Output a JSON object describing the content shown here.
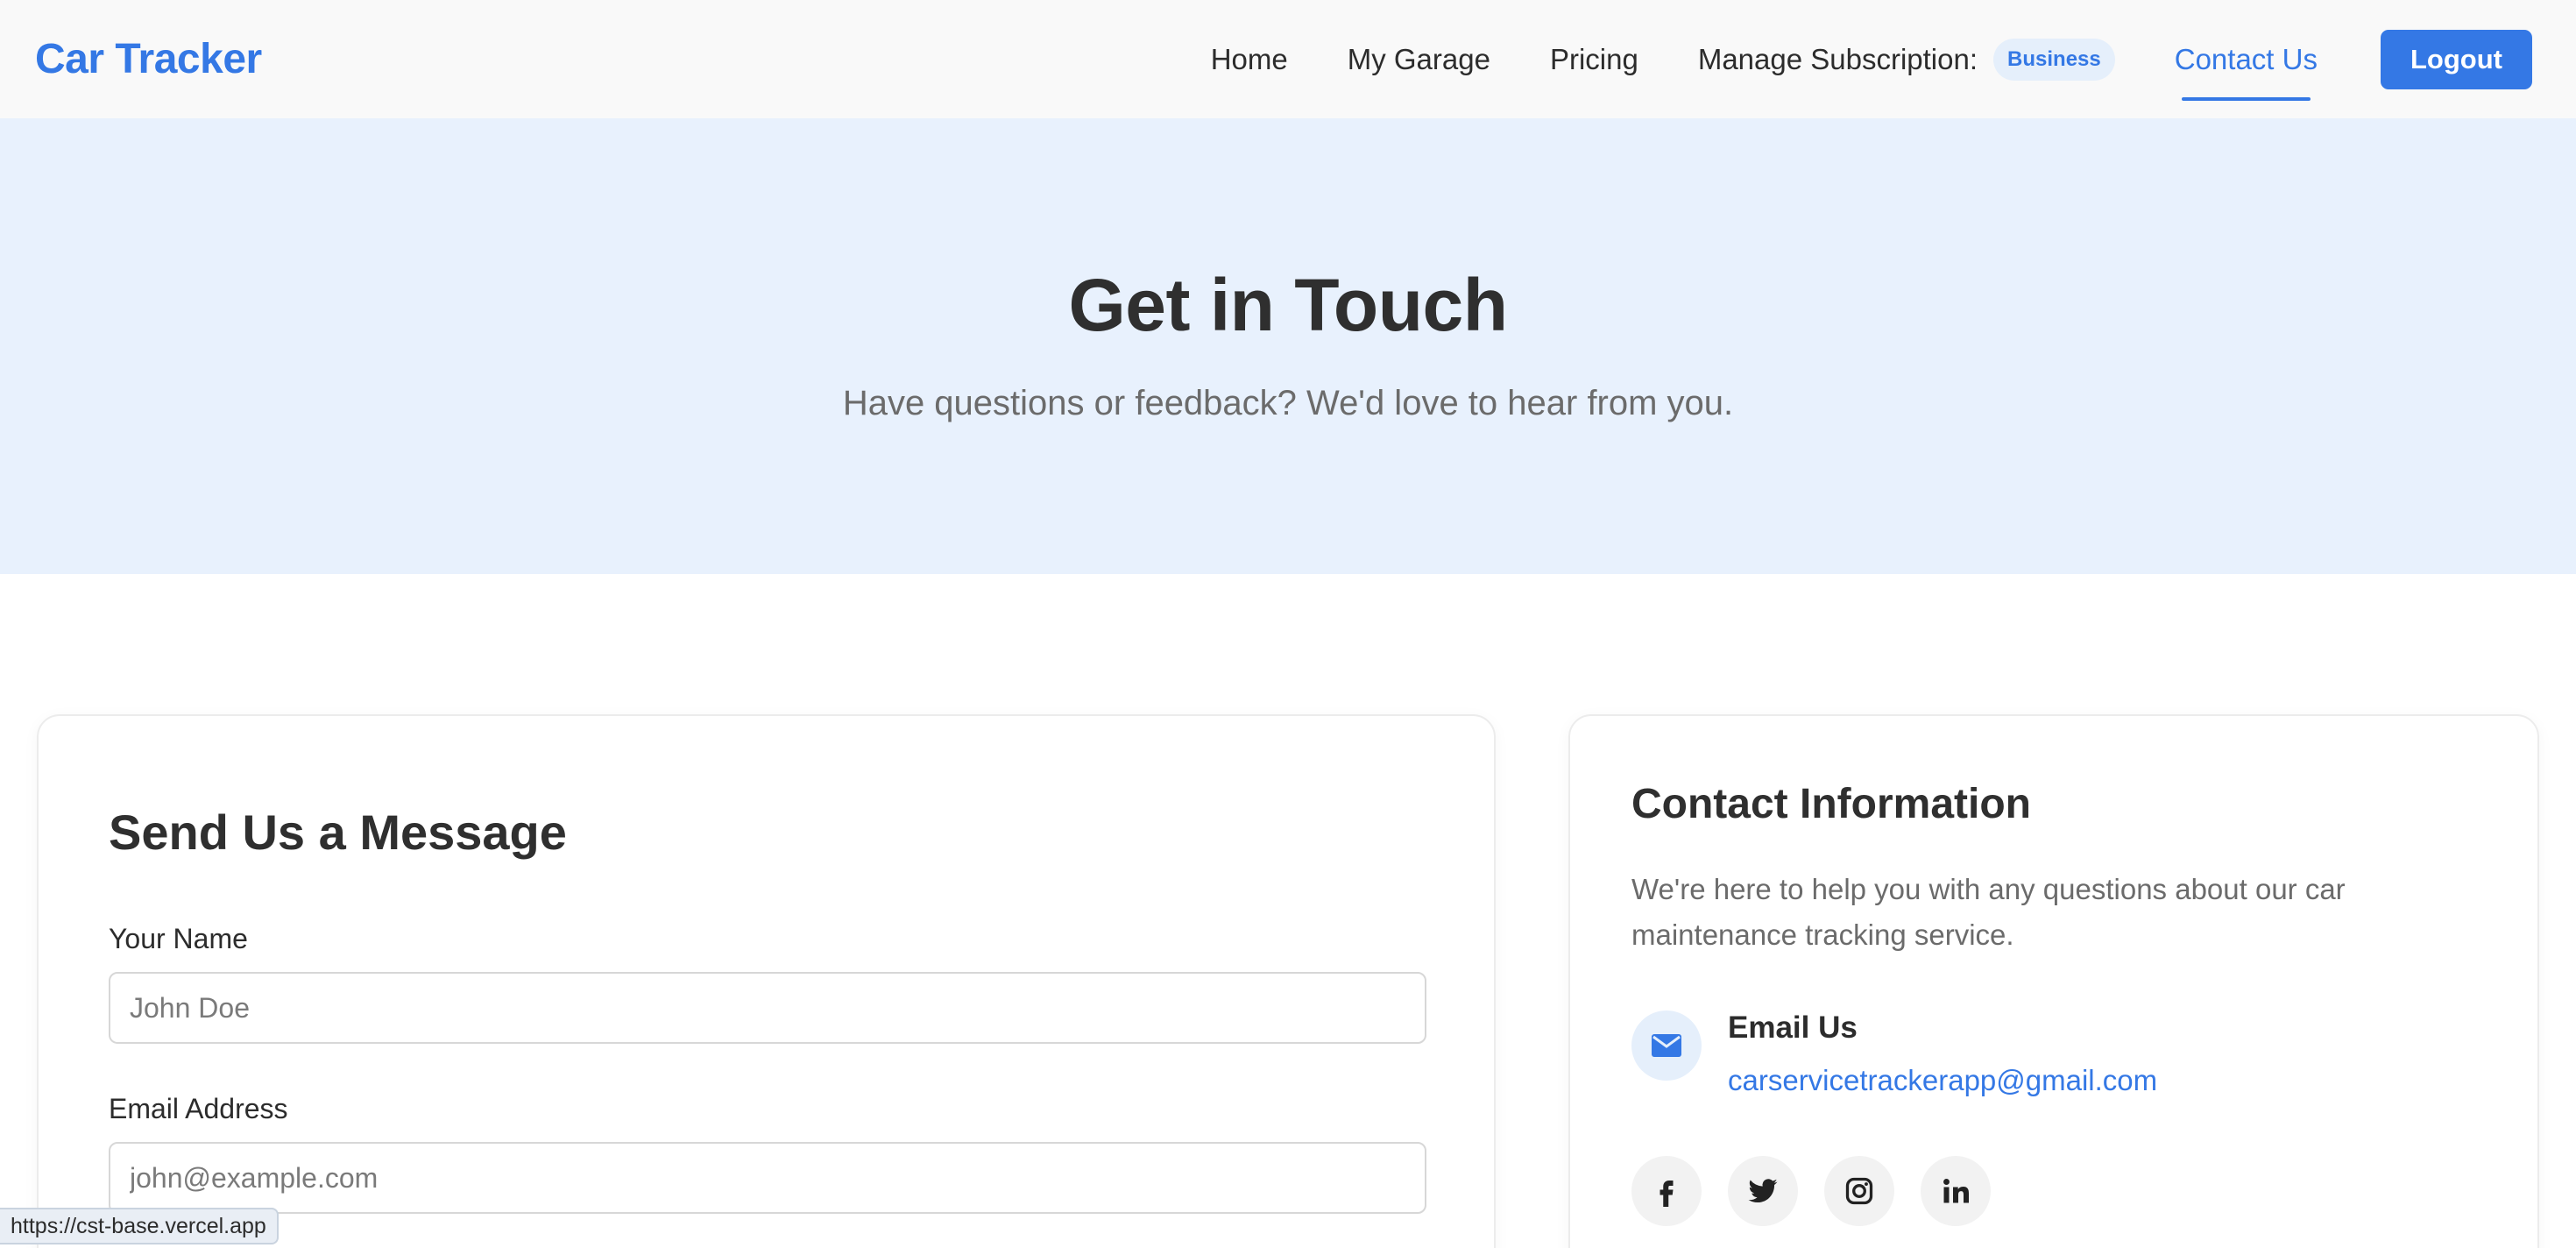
{
  "navbar": {
    "brand": "Car Tracker",
    "links": {
      "home": "Home",
      "garage": "My Garage",
      "pricing": "Pricing",
      "subscription": "Manage Subscription:",
      "contact": "Contact Us"
    },
    "subscription_badge": "Business",
    "logout_label": "Logout"
  },
  "hero": {
    "title": "Get in Touch",
    "subtitle": "Have questions or feedback? We'd love to hear from you."
  },
  "form": {
    "title": "Send Us a Message",
    "name_label": "Your Name",
    "name_placeholder": "John Doe",
    "name_value": "",
    "email_label": "Email Address",
    "email_placeholder": "john@example.com",
    "email_value": ""
  },
  "contact": {
    "title": "Contact Information",
    "description": "We're here to help you with any questions about our car maintenance tracking service.",
    "email_heading": "Email Us",
    "email_address": "carservicetrackerapp@gmail.com",
    "socials": [
      "facebook-icon",
      "twitter-icon",
      "instagram-icon",
      "linkedin-icon"
    ]
  },
  "status_url": "https://cst-base.vercel.app",
  "colors": {
    "accent": "#3478e5",
    "hero_bg": "#e8f1fd",
    "badge_bg": "#e5effb"
  }
}
